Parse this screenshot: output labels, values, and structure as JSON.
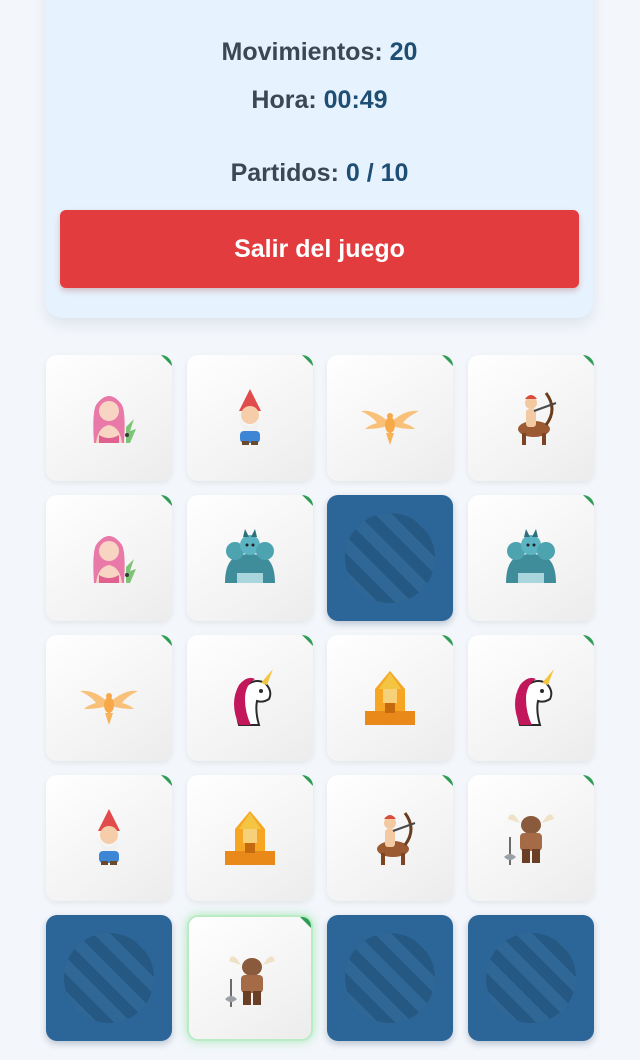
{
  "stats": {
    "moves_label": "Movimientos:",
    "moves_value": "20",
    "time_label": "Hora:",
    "time_value": "00:49",
    "matches_label": "Partidos:",
    "matches_value": "0 / 10"
  },
  "exit_button": {
    "label": "Salir del juego"
  },
  "colors": {
    "accent": "#1f4e74",
    "danger": "#e23c3f",
    "card_back": "#2c6597",
    "matched_marker": "#2e9c55"
  },
  "board": {
    "cards": [
      {
        "state": "face",
        "icon": "mermaid-icon"
      },
      {
        "state": "face",
        "icon": "gnome-icon"
      },
      {
        "state": "face",
        "icon": "phoenix-icon"
      },
      {
        "state": "face",
        "icon": "centaur-icon"
      },
      {
        "state": "face",
        "icon": "mermaid-icon"
      },
      {
        "state": "face",
        "icon": "cerberus-icon"
      },
      {
        "state": "back",
        "icon": "card-back-icon"
      },
      {
        "state": "face",
        "icon": "cerberus-icon"
      },
      {
        "state": "face",
        "icon": "phoenix-icon"
      },
      {
        "state": "face",
        "icon": "unicorn-icon"
      },
      {
        "state": "face",
        "icon": "sphinx-icon"
      },
      {
        "state": "face",
        "icon": "unicorn-icon"
      },
      {
        "state": "face",
        "icon": "gnome-icon"
      },
      {
        "state": "face",
        "icon": "sphinx-icon"
      },
      {
        "state": "face",
        "icon": "centaur-icon"
      },
      {
        "state": "face",
        "icon": "minotaur-icon"
      },
      {
        "state": "back",
        "icon": "card-back-icon"
      },
      {
        "state": "face",
        "icon": "minotaur-icon",
        "highlighted": true
      },
      {
        "state": "back",
        "icon": "card-back-icon"
      },
      {
        "state": "back",
        "icon": "card-back-icon"
      }
    ]
  }
}
